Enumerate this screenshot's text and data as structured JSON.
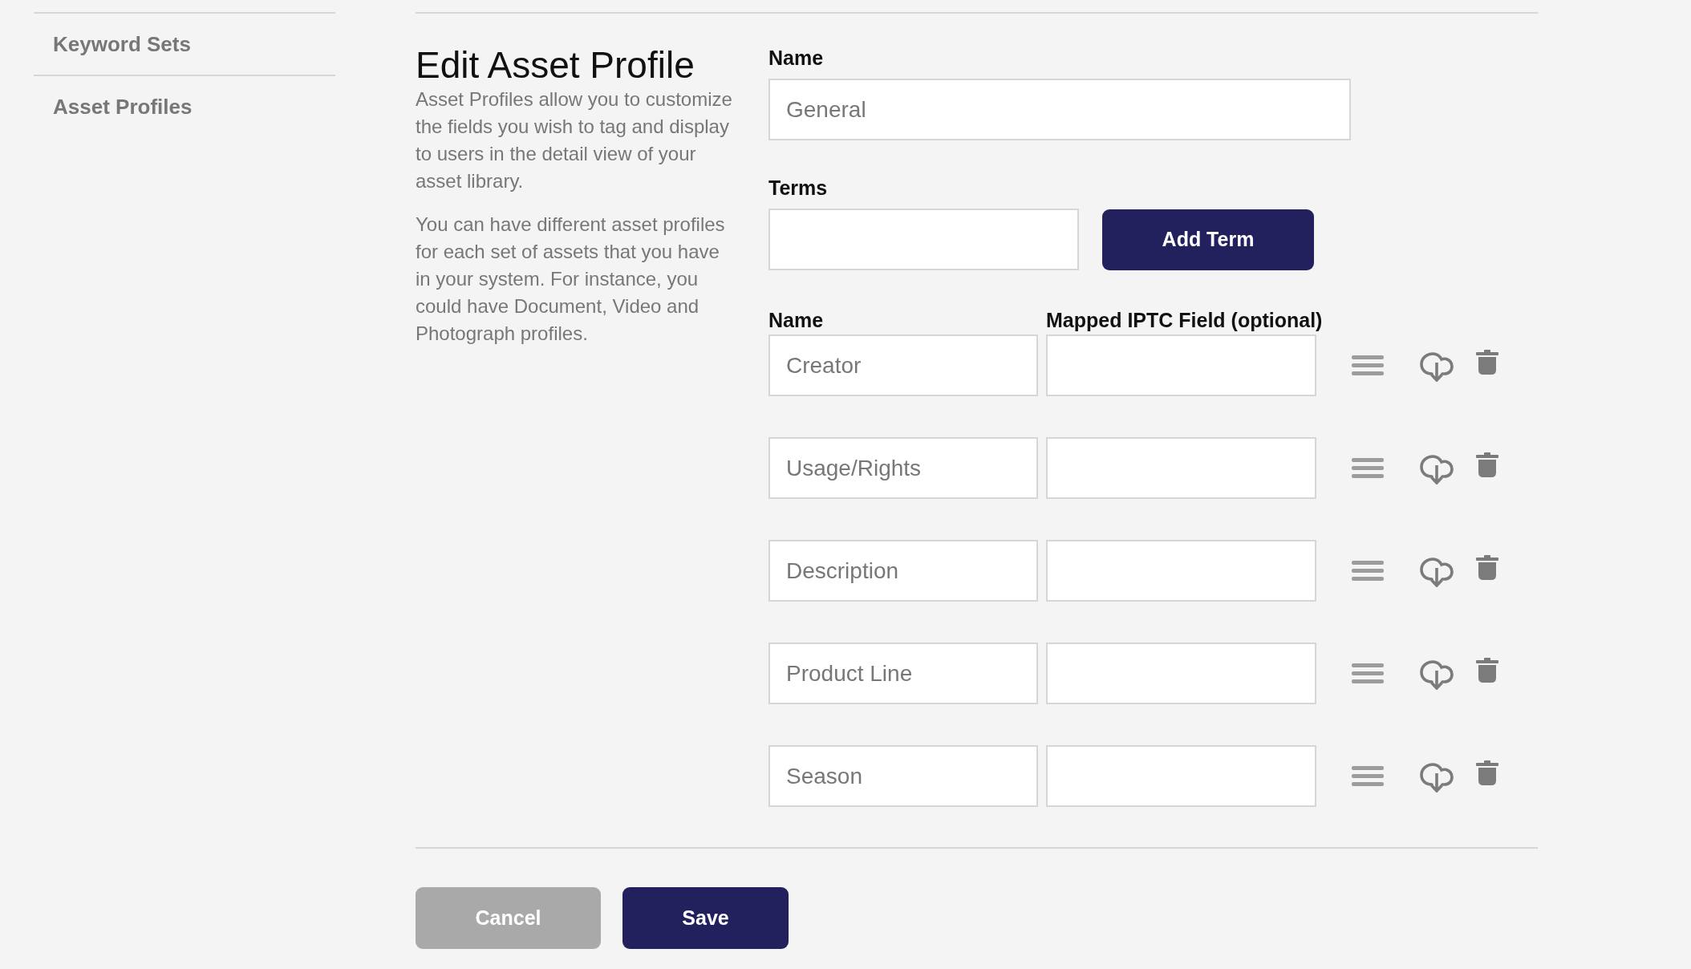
{
  "sidebar": {
    "items": [
      {
        "label": "Keyword Sets"
      },
      {
        "label": "Asset Profiles"
      }
    ]
  },
  "intro": {
    "title": "Edit Asset Profile",
    "paragraphs": [
      "Asset Profiles allow you to customize the fields you wish to tag and display to users in the detail view of your asset library.",
      "You can have different asset profiles for each set of assets that you have in your system. For instance, you could have Document, Video and Photograph profiles."
    ]
  },
  "form": {
    "name_field": {
      "label": "Name",
      "value": "General"
    },
    "terms_field": {
      "label": "Terms",
      "button": "Add Term"
    },
    "terms_table": {
      "columns": [
        "Name",
        "Mapped IPTC Field (optional)"
      ],
      "rows": [
        {
          "name": "Creator"
        },
        {
          "name": "Usage/Rights"
        },
        {
          "name": "Description"
        },
        {
          "name": "Product Line"
        },
        {
          "name": "Season"
        }
      ]
    }
  },
  "buttons": [
    {
      "label": "Cancel",
      "kind": "cancel"
    },
    {
      "label": "Save",
      "kind": "save"
    }
  ]
}
